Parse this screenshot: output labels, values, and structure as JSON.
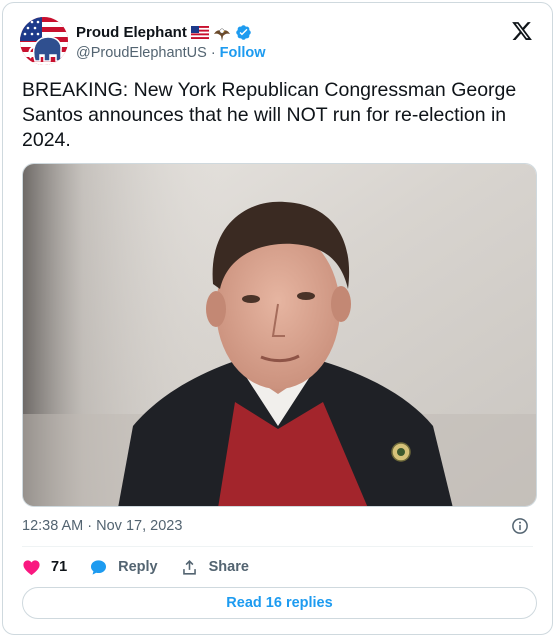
{
  "author": {
    "display_name": "Proud Elephant",
    "handle": "@ProudElephantUS",
    "separator": "·",
    "follow_label": "Follow",
    "emoji_icons": [
      "us-flag-icon",
      "eagle-icon"
    ],
    "verified_icon": "verified-badge-icon"
  },
  "tweet": {
    "text": "BREAKING: New York Republican Congressman George Santos announces that he will NOT run for re-election in 2024.",
    "timestamp": "12:38 AM · Nov 17, 2023"
  },
  "actions": {
    "like_count": "71",
    "reply_label": "Reply",
    "share_label": "Share",
    "read_replies_label": "Read 16 replies"
  },
  "colors": {
    "accent": "#1d9bf0",
    "like": "#f91880",
    "text": "#0f1419",
    "secondary": "#536471",
    "border": "#cfd9de"
  }
}
